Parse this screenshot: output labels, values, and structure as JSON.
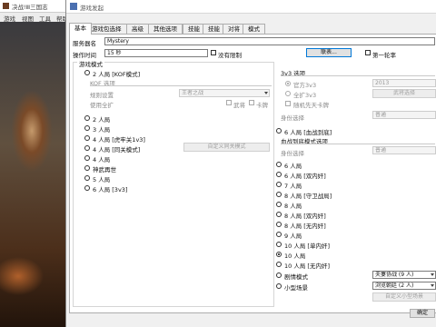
{
  "background_window": {
    "title": "决战!Ⅲ三国志",
    "menu": [
      "游戏",
      "视图",
      "工具",
      "帮助"
    ]
  },
  "dialog": {
    "title": "游戏发起",
    "tabs": [
      "基本",
      "游戏包选择",
      "高级",
      "其他选项",
      "技能",
      "技能",
      "对将",
      "模式"
    ],
    "server_name_label": "服务器名",
    "server_name_value": "Mystery",
    "op_time_label": "操作时间",
    "op_time_value": "15 秒",
    "no_limit_label": "没有限制",
    "lobby_button": "联表...",
    "first_round_label": "第一轮率",
    "game_mode_group": "游戏模式",
    "modes": [
      {
        "label": "2 人局 [KOF模式]",
        "selected": false
      },
      {
        "label": "2 人局",
        "selected": false
      },
      {
        "label": "3 人局",
        "selected": false
      },
      {
        "label": "4 人局 [虎牢关1v3]",
        "selected": false
      },
      {
        "label": "4 人局 [同关模式]",
        "selected": false
      },
      {
        "label": "4 人局",
        "selected": false
      },
      {
        "label": "神武再世",
        "selected": false
      },
      {
        "label": "5 人局",
        "selected": false
      },
      {
        "label": "6 人局 [3v3]",
        "selected": false
      }
    ],
    "kof_group": "KOF 选项",
    "kof_rule_label": "规则设置",
    "kof_rule_value": "王者之战",
    "kof_expand_label": "使用全扩",
    "kof_opt1": "武将",
    "kof_opt2": "卡牌",
    "custom_hegemony_button": "自定义同关模式",
    "v3_group": "3v3 选项",
    "v3_official": "官方3v3",
    "v3_official_value": "2013",
    "v3_extended": "全扩3v3",
    "v3_select_button": "武将选择",
    "v3_random_label": "随机先天卡牌",
    "v3_identity_label": "身份选择",
    "v3_identity_value": "普通",
    "six_p_doubled": "6 人局 [血战到底]",
    "blood_group": "血战到底模式选项",
    "blood_identity_label": "身份选择",
    "blood_identity_value": "普通",
    "right_modes": [
      {
        "label": "6 人局",
        "selected": false
      },
      {
        "label": "6 人局 [双内奸]",
        "selected": false
      },
      {
        "label": "7 人局",
        "selected": false
      },
      {
        "label": "8 人局 [守卫战局]",
        "selected": false
      },
      {
        "label": "8 人局",
        "selected": false
      },
      {
        "label": "8 人局 [双内奸]",
        "selected": false
      },
      {
        "label": "8 人局 [无内奸]",
        "selected": false
      },
      {
        "label": "9 人局",
        "selected": false
      },
      {
        "label": "10 人局 [单内奸]",
        "selected": false
      },
      {
        "label": "10 人局",
        "selected": true
      },
      {
        "label": "10 人局 [无内奸]",
        "selected": false
      },
      {
        "label": "剧情模式",
        "selected": false
      },
      {
        "label": "小型场景",
        "selected": false
      }
    ],
    "scenario_value": "夫妻协战 (9 人)",
    "small_scenario_value": "浏览朝廷 (2 人)",
    "custom_scene_button": "自定义小型场景",
    "ok_button": "确定"
  }
}
